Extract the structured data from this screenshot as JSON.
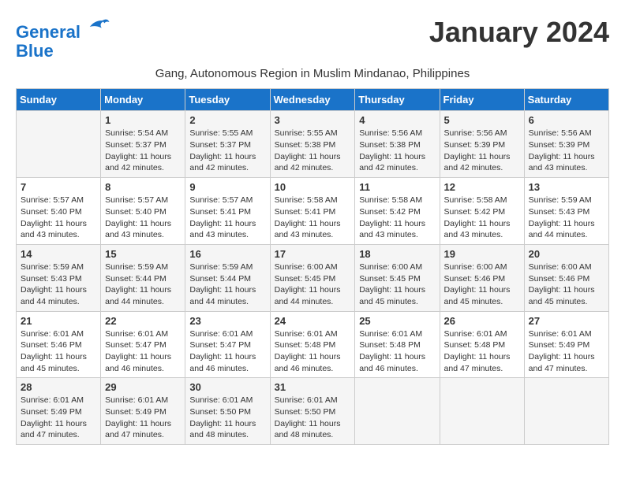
{
  "logo": {
    "line1": "General",
    "line2": "Blue"
  },
  "title": "January 2024",
  "subtitle": "Gang, Autonomous Region in Muslim Mindanao, Philippines",
  "days_header": [
    "Sunday",
    "Monday",
    "Tuesday",
    "Wednesday",
    "Thursday",
    "Friday",
    "Saturday"
  ],
  "weeks": [
    [
      {
        "day": "",
        "info": ""
      },
      {
        "day": "1",
        "info": "Sunrise: 5:54 AM\nSunset: 5:37 PM\nDaylight: 11 hours and 42 minutes."
      },
      {
        "day": "2",
        "info": "Sunrise: 5:55 AM\nSunset: 5:37 PM\nDaylight: 11 hours and 42 minutes."
      },
      {
        "day": "3",
        "info": "Sunrise: 5:55 AM\nSunset: 5:38 PM\nDaylight: 11 hours and 42 minutes."
      },
      {
        "day": "4",
        "info": "Sunrise: 5:56 AM\nSunset: 5:38 PM\nDaylight: 11 hours and 42 minutes."
      },
      {
        "day": "5",
        "info": "Sunrise: 5:56 AM\nSunset: 5:39 PM\nDaylight: 11 hours and 42 minutes."
      },
      {
        "day": "6",
        "info": "Sunrise: 5:56 AM\nSunset: 5:39 PM\nDaylight: 11 hours and 43 minutes."
      }
    ],
    [
      {
        "day": "7",
        "info": "Sunrise: 5:57 AM\nSunset: 5:40 PM\nDaylight: 11 hours and 43 minutes."
      },
      {
        "day": "8",
        "info": "Sunrise: 5:57 AM\nSunset: 5:40 PM\nDaylight: 11 hours and 43 minutes."
      },
      {
        "day": "9",
        "info": "Sunrise: 5:57 AM\nSunset: 5:41 PM\nDaylight: 11 hours and 43 minutes."
      },
      {
        "day": "10",
        "info": "Sunrise: 5:58 AM\nSunset: 5:41 PM\nDaylight: 11 hours and 43 minutes."
      },
      {
        "day": "11",
        "info": "Sunrise: 5:58 AM\nSunset: 5:42 PM\nDaylight: 11 hours and 43 minutes."
      },
      {
        "day": "12",
        "info": "Sunrise: 5:58 AM\nSunset: 5:42 PM\nDaylight: 11 hours and 43 minutes."
      },
      {
        "day": "13",
        "info": "Sunrise: 5:59 AM\nSunset: 5:43 PM\nDaylight: 11 hours and 44 minutes."
      }
    ],
    [
      {
        "day": "14",
        "info": "Sunrise: 5:59 AM\nSunset: 5:43 PM\nDaylight: 11 hours and 44 minutes."
      },
      {
        "day": "15",
        "info": "Sunrise: 5:59 AM\nSunset: 5:44 PM\nDaylight: 11 hours and 44 minutes."
      },
      {
        "day": "16",
        "info": "Sunrise: 5:59 AM\nSunset: 5:44 PM\nDaylight: 11 hours and 44 minutes."
      },
      {
        "day": "17",
        "info": "Sunrise: 6:00 AM\nSunset: 5:45 PM\nDaylight: 11 hours and 44 minutes."
      },
      {
        "day": "18",
        "info": "Sunrise: 6:00 AM\nSunset: 5:45 PM\nDaylight: 11 hours and 45 minutes."
      },
      {
        "day": "19",
        "info": "Sunrise: 6:00 AM\nSunset: 5:46 PM\nDaylight: 11 hours and 45 minutes."
      },
      {
        "day": "20",
        "info": "Sunrise: 6:00 AM\nSunset: 5:46 PM\nDaylight: 11 hours and 45 minutes."
      }
    ],
    [
      {
        "day": "21",
        "info": "Sunrise: 6:01 AM\nSunset: 5:46 PM\nDaylight: 11 hours and 45 minutes."
      },
      {
        "day": "22",
        "info": "Sunrise: 6:01 AM\nSunset: 5:47 PM\nDaylight: 11 hours and 46 minutes."
      },
      {
        "day": "23",
        "info": "Sunrise: 6:01 AM\nSunset: 5:47 PM\nDaylight: 11 hours and 46 minutes."
      },
      {
        "day": "24",
        "info": "Sunrise: 6:01 AM\nSunset: 5:48 PM\nDaylight: 11 hours and 46 minutes."
      },
      {
        "day": "25",
        "info": "Sunrise: 6:01 AM\nSunset: 5:48 PM\nDaylight: 11 hours and 46 minutes."
      },
      {
        "day": "26",
        "info": "Sunrise: 6:01 AM\nSunset: 5:48 PM\nDaylight: 11 hours and 47 minutes."
      },
      {
        "day": "27",
        "info": "Sunrise: 6:01 AM\nSunset: 5:49 PM\nDaylight: 11 hours and 47 minutes."
      }
    ],
    [
      {
        "day": "28",
        "info": "Sunrise: 6:01 AM\nSunset: 5:49 PM\nDaylight: 11 hours and 47 minutes."
      },
      {
        "day": "29",
        "info": "Sunrise: 6:01 AM\nSunset: 5:49 PM\nDaylight: 11 hours and 47 minutes."
      },
      {
        "day": "30",
        "info": "Sunrise: 6:01 AM\nSunset: 5:50 PM\nDaylight: 11 hours and 48 minutes."
      },
      {
        "day": "31",
        "info": "Sunrise: 6:01 AM\nSunset: 5:50 PM\nDaylight: 11 hours and 48 minutes."
      },
      {
        "day": "",
        "info": ""
      },
      {
        "day": "",
        "info": ""
      },
      {
        "day": "",
        "info": ""
      }
    ]
  ]
}
